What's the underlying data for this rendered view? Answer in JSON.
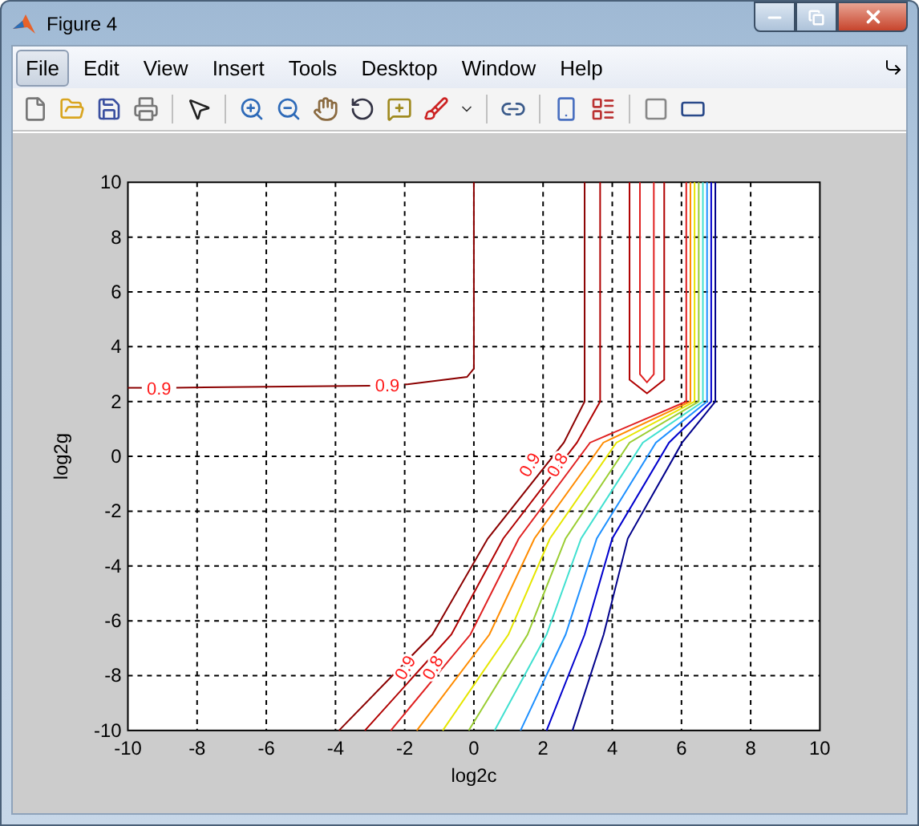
{
  "window": {
    "title": "Figure 4"
  },
  "menu": [
    {
      "label": "File",
      "selected": true
    },
    {
      "label": "Edit",
      "selected": false
    },
    {
      "label": "View",
      "selected": false
    },
    {
      "label": "Insert",
      "selected": false
    },
    {
      "label": "Tools",
      "selected": false
    },
    {
      "label": "Desktop",
      "selected": false
    },
    {
      "label": "Window",
      "selected": false
    },
    {
      "label": "Help",
      "selected": false
    }
  ],
  "axes": {
    "xlabel": "log2c",
    "ylabel": "log2g",
    "xticks": [
      "-10",
      "-8",
      "-6",
      "-4",
      "-2",
      "0",
      "2",
      "4",
      "6",
      "8",
      "10"
    ],
    "yticks": [
      "10",
      "8",
      "6",
      "4",
      "2",
      "0",
      "-2",
      "-4",
      "-6",
      "-8",
      "-10"
    ],
    "contour_labels": [
      {
        "text": "0.9"
      },
      {
        "text": "0.9"
      },
      {
        "text": "0.9"
      },
      {
        "text": "0.8"
      },
      {
        "text": "0.9"
      },
      {
        "text": "0.8"
      }
    ]
  }
}
